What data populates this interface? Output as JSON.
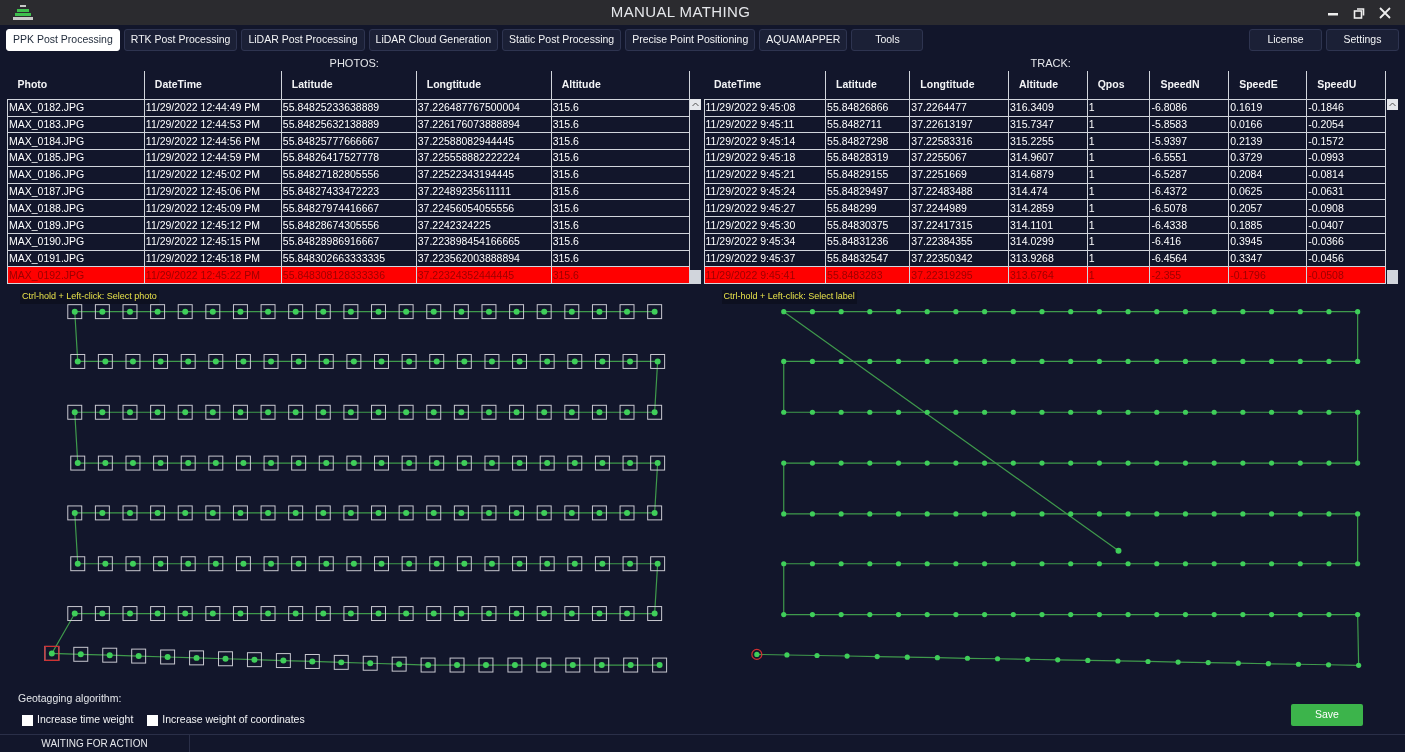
{
  "window": {
    "title": "MANUAL MATHING"
  },
  "tabs": [
    {
      "label": "PPK Post Processing",
      "selected": true
    },
    {
      "label": "RTK Post Processing",
      "selected": false
    },
    {
      "label": "LiDAR Post Processing",
      "selected": false
    },
    {
      "label": "LiDAR Cloud Generation",
      "selected": false
    },
    {
      "label": "Static Post Processing",
      "selected": false
    },
    {
      "label": "Precise Point Positioning",
      "selected": false
    },
    {
      "label": "AQUAMAPPER",
      "selected": false
    },
    {
      "label": "Tools",
      "selected": false
    }
  ],
  "right_buttons": [
    "License",
    "Settings"
  ],
  "photos": {
    "title": "PHOTOS:",
    "columns": [
      "Photo",
      "DateTime",
      "Latitude",
      "Longtitude",
      "Altitude"
    ],
    "rows": [
      {
        "cells": [
          "MAX_0182.JPG",
          "11/29/2022 12:44:49 PM",
          "55.84825233638889",
          "37.226487767500004",
          "315.6"
        ],
        "selected": false
      },
      {
        "cells": [
          "MAX_0183.JPG",
          "11/29/2022 12:44:53 PM",
          "55.84825632138889",
          "37.226176073888894",
          "315.6"
        ],
        "selected": false
      },
      {
        "cells": [
          "MAX_0184.JPG",
          "11/29/2022 12:44:56 PM",
          "55.84825777666667",
          "37.22588082944445",
          "315.6"
        ],
        "selected": false
      },
      {
        "cells": [
          "MAX_0185.JPG",
          "11/29/2022 12:44:59 PM",
          "55.84826417527778",
          "37.225558882222224",
          "315.6"
        ],
        "selected": false
      },
      {
        "cells": [
          "MAX_0186.JPG",
          "11/29/2022 12:45:02 PM",
          "55.84827182805556",
          "37.22522343194445",
          "315.6"
        ],
        "selected": false
      },
      {
        "cells": [
          "MAX_0187.JPG",
          "11/29/2022 12:45:06 PM",
          "55.84827433472223",
          "37.22489235611111",
          "315.6"
        ],
        "selected": false
      },
      {
        "cells": [
          "MAX_0188.JPG",
          "11/29/2022 12:45:09 PM",
          "55.84827974416667",
          "37.22456054055556",
          "315.6"
        ],
        "selected": false
      },
      {
        "cells": [
          "MAX_0189.JPG",
          "11/29/2022 12:45:12 PM",
          "55.84828674305556",
          "37.2242324225",
          "315.6"
        ],
        "selected": false
      },
      {
        "cells": [
          "MAX_0190.JPG",
          "11/29/2022 12:45:15 PM",
          "55.84828986916667",
          "37.223898454166665",
          "315.6"
        ],
        "selected": false
      },
      {
        "cells": [
          "MAX_0191.JPG",
          "11/29/2022 12:45:18 PM",
          "55.848302663333335",
          "37.223562003888894",
          "315.6"
        ],
        "selected": false
      },
      {
        "cells": [
          "MAX_0192.JPG",
          "11/29/2022 12:45:22 PM",
          "55.848308128333336",
          "37.22324352444445",
          "315.6"
        ],
        "selected": true
      }
    ]
  },
  "track": {
    "title": "TRACK:",
    "columns": [
      "DateTime",
      "Latitude",
      "Longtitude",
      "Altitude",
      "Qpos",
      "SpeedN",
      "SpeedE",
      "SpeedU"
    ],
    "rows": [
      {
        "cells": [
          "11/29/2022 9:45:08",
          "55.84826866",
          "37.2264477",
          "316.3409",
          "1",
          "-6.8086",
          "0.1619",
          "-0.1846"
        ],
        "selected": false
      },
      {
        "cells": [
          "11/29/2022 9:45:11",
          "55.8482711",
          "37.22613197",
          "315.7347",
          "1",
          "-5.8583",
          "0.0166",
          "-0.2054"
        ],
        "selected": false
      },
      {
        "cells": [
          "11/29/2022 9:45:14",
          "55.84827298",
          "37.22583316",
          "315.2255",
          "1",
          "-5.9397",
          "0.2139",
          "-0.1572"
        ],
        "selected": false
      },
      {
        "cells": [
          "11/29/2022 9:45:18",
          "55.84828319",
          "37.2255067",
          "314.9607",
          "1",
          "-6.5551",
          "0.3729",
          "-0.0993"
        ],
        "selected": false
      },
      {
        "cells": [
          "11/29/2022 9:45:21",
          "55.84829155",
          "37.2251669",
          "314.6879",
          "1",
          "-6.5287",
          "0.2084",
          "-0.0814"
        ],
        "selected": false
      },
      {
        "cells": [
          "11/29/2022 9:45:24",
          "55.84829497",
          "37.22483488",
          "314.474",
          "1",
          "-6.4372",
          "0.0625",
          "-0.0631"
        ],
        "selected": false
      },
      {
        "cells": [
          "11/29/2022 9:45:27",
          "55.848299",
          "37.2244989",
          "314.2859",
          "1",
          "-6.5078",
          "0.2057",
          "-0.0908"
        ],
        "selected": false
      },
      {
        "cells": [
          "11/29/2022 9:45:30",
          "55.84830375",
          "37.22417315",
          "314.1101",
          "1",
          "-6.4338",
          "0.1885",
          "-0.0407"
        ],
        "selected": false
      },
      {
        "cells": [
          "11/29/2022 9:45:34",
          "55.84831236",
          "37.22384355",
          "314.0299",
          "1",
          "-6.416",
          "0.3945",
          "-0.0366"
        ],
        "selected": false
      },
      {
        "cells": [
          "11/29/2022 9:45:37",
          "55.84832547",
          "37.22350342",
          "313.9268",
          "1",
          "-6.4564",
          "0.3347",
          "-0.0456"
        ],
        "selected": false
      },
      {
        "cells": [
          "11/29/2022 9:45:41",
          "55.8483283",
          "37.22319295",
          "313.6764",
          "1",
          "-2.355",
          "-0.1796",
          "-0.0508"
        ],
        "selected": true
      }
    ]
  },
  "photo_plot": {
    "hint": "Ctrl-hold + Left-click: Select photo"
  },
  "track_plot": {
    "hint": "Ctrl-hold + Left-click: Select label"
  },
  "geotagging": {
    "label": "Geotagging algorithm:",
    "options": [
      {
        "label": "Increase time weight",
        "checked": false
      },
      {
        "label": "Increase weight of coordinates",
        "checked": false
      }
    ]
  },
  "save_button": "Save",
  "status_bar": "WAITING FOR ACTION"
}
